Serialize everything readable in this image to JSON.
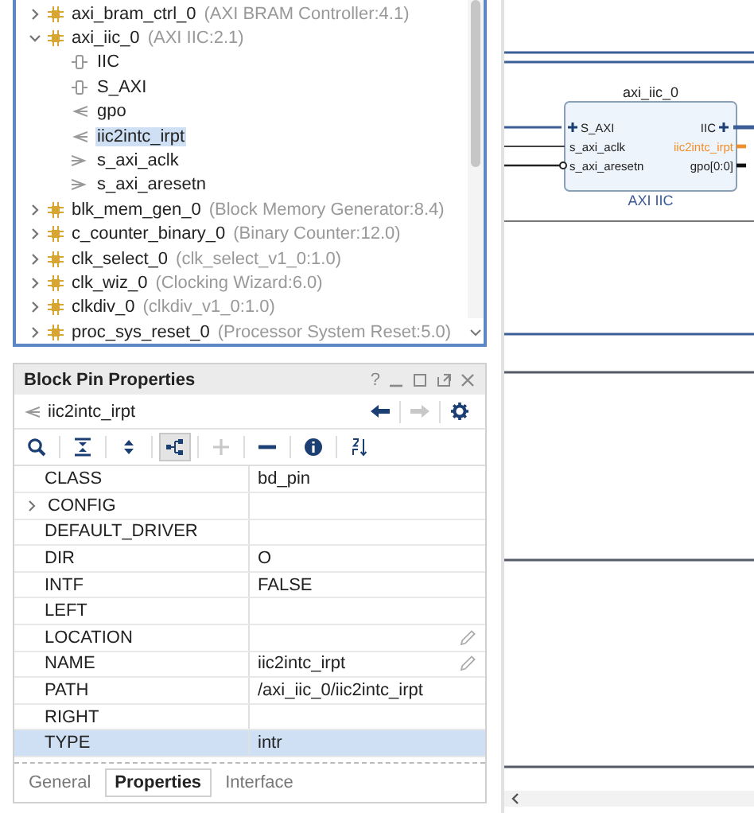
{
  "tree": {
    "items": [
      {
        "name": "axi_bram_ctrl_0",
        "detail": "(AXI BRAM Controller:4.1)",
        "expanded": false
      },
      {
        "name": "axi_iic_0",
        "detail": "(AXI IIC:2.1)",
        "expanded": true,
        "children": [
          {
            "name": "IIC",
            "kind": "interface",
            "selected": false
          },
          {
            "name": "S_AXI",
            "kind": "interface",
            "selected": false
          },
          {
            "name": "gpo",
            "kind": "output",
            "selected": false
          },
          {
            "name": "iic2intc_irpt",
            "kind": "output",
            "selected": true
          },
          {
            "name": "s_axi_aclk",
            "kind": "input",
            "selected": false
          },
          {
            "name": "s_axi_aresetn",
            "kind": "input",
            "selected": false
          }
        ]
      },
      {
        "name": "blk_mem_gen_0",
        "detail": "(Block Memory Generator:8.4)",
        "expanded": false
      },
      {
        "name": "c_counter_binary_0",
        "detail": "(Binary Counter:12.0)",
        "expanded": false
      },
      {
        "name": "clk_select_0",
        "detail": "(clk_select_v1_0:1.0)",
        "expanded": false
      },
      {
        "name": "clk_wiz_0",
        "detail": "(Clocking Wizard:6.0)",
        "expanded": false
      },
      {
        "name": "clkdiv_0",
        "detail": "(clkdiv_v1_0:1.0)",
        "expanded": false
      },
      {
        "name": "proc_sys_reset_0",
        "detail": "(Processor System Reset:5.0)",
        "expanded": false
      }
    ]
  },
  "properties": {
    "title": "Block Pin Properties",
    "help": "?",
    "object": "iic2intc_irpt",
    "tools": [
      {
        "kind": "search",
        "selected": false,
        "disabled": false
      },
      {
        "kind": "collapse",
        "selected": false,
        "disabled": false
      },
      {
        "kind": "expand",
        "selected": false,
        "disabled": false
      },
      {
        "kind": "hierarchy",
        "selected": true,
        "disabled": false
      },
      {
        "kind": "add",
        "selected": false,
        "disabled": true
      },
      {
        "kind": "remove",
        "selected": false,
        "disabled": false
      },
      {
        "kind": "info",
        "selected": false,
        "disabled": false
      },
      {
        "kind": "sort",
        "selected": false,
        "disabled": false
      }
    ],
    "rows": [
      {
        "name": "CLASS",
        "value": "bd_pin",
        "expandable": false,
        "editable": false,
        "selected": false
      },
      {
        "name": "CONFIG",
        "value": "",
        "expandable": true,
        "editable": false,
        "selected": false
      },
      {
        "name": "DEFAULT_DRIVER",
        "value": "",
        "expandable": false,
        "editable": false,
        "selected": false
      },
      {
        "name": "DIR",
        "value": "O",
        "expandable": false,
        "editable": false,
        "selected": false
      },
      {
        "name": "INTF",
        "value": "FALSE",
        "expandable": false,
        "editable": false,
        "selected": false
      },
      {
        "name": "LEFT",
        "value": "",
        "expandable": false,
        "editable": false,
        "selected": false
      },
      {
        "name": "LOCATION",
        "value": "",
        "expandable": false,
        "editable": true,
        "selected": false
      },
      {
        "name": "NAME",
        "value": "iic2intc_irpt",
        "expandable": false,
        "editable": true,
        "selected": false
      },
      {
        "name": "PATH",
        "value": "/axi_iic_0/iic2intc_irpt",
        "expandable": false,
        "editable": false,
        "selected": false
      },
      {
        "name": "RIGHT",
        "value": "",
        "expandable": false,
        "editable": false,
        "selected": false
      },
      {
        "name": "TYPE",
        "value": "intr",
        "expandable": false,
        "editable": false,
        "selected": true
      }
    ],
    "tabs": [
      {
        "label": "General",
        "selected": false
      },
      {
        "label": "Properties",
        "selected": true
      },
      {
        "label": "Interface",
        "selected": false
      }
    ]
  },
  "diagram": {
    "block": {
      "title": "axi_iic_0",
      "subtitle": "AXI IIC",
      "left_pins": [
        {
          "label": "S_AXI",
          "kind": "interface"
        },
        {
          "label": "s_axi_aclk",
          "kind": "input"
        },
        {
          "label": "s_axi_aresetn",
          "kind": "reset"
        }
      ],
      "right_pins": [
        {
          "label": "IIC",
          "kind": "interface",
          "highlighted": false
        },
        {
          "label": "iic2intc_irpt",
          "kind": "output",
          "highlighted": true
        },
        {
          "label": "gpo[0:0]",
          "kind": "output",
          "highlighted": false
        }
      ]
    }
  }
}
